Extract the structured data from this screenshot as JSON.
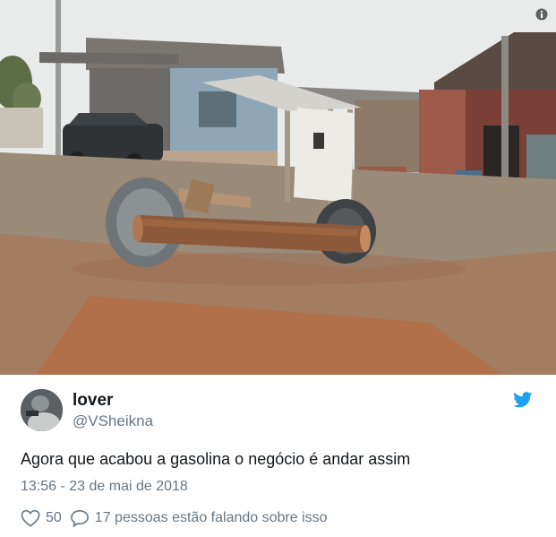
{
  "media": {
    "description_icon": "info-icon"
  },
  "user": {
    "name": "lover",
    "handle": "@VSheikna",
    "avatar_icon": "avatar-image"
  },
  "brand": {
    "icon": "twitter-bird-icon",
    "color": "#1da1f2"
  },
  "tweet": {
    "text": "Agora que acabou a gasolina o negócio é andar assim",
    "timestamp": "13:56 - 23 de mai de 2018"
  },
  "actions": {
    "likes": "50",
    "replies_text": "17 pessoas estão falando sobre isso",
    "like_icon": "heart-icon",
    "reply_icon": "speech-bubble-icon"
  },
  "colors": {
    "text_primary": "#14171a",
    "text_secondary": "#657786"
  }
}
